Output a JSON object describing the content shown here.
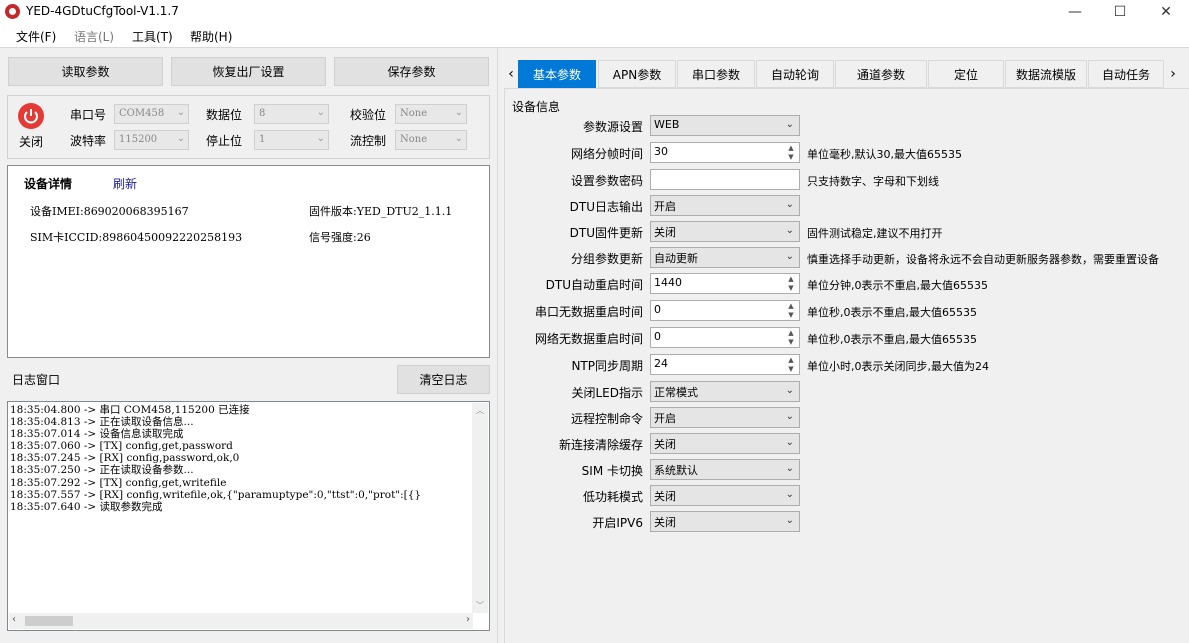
{
  "window": {
    "title": "YED-4GDtuCfgTool-V1.1.7",
    "minimize": "—",
    "maximize": "☐",
    "close": "✕"
  },
  "menu": [
    "文件(F)",
    "语言(L)",
    "工具(T)",
    "帮助(H)"
  ],
  "toolbar": {
    "read": "读取参数",
    "factory": "恢复出厂设置",
    "save": "保存参数"
  },
  "serial": {
    "close_label": "关闭",
    "port_label": "串口号",
    "port_value": "COM458",
    "baud_label": "波特率",
    "baud_value": "115200",
    "data_label": "数据位",
    "data_value": "8",
    "stop_label": "停止位",
    "stop_value": "1",
    "parity_label": "校验位",
    "parity_value": "None",
    "flow_label": "流控制",
    "flow_value": "None"
  },
  "device": {
    "title": "设备详情",
    "refresh": "刷新",
    "imei": "设备IMEI:869020068395167",
    "firmware": "固件版本:YED_DTU2_1.1.1",
    "iccid": "SIM卡ICCID:89860450092220258193",
    "signal": "信号强度:26"
  },
  "log": {
    "title": "日志窗口",
    "clear": "清空日志",
    "lines": [
      "18:35:04.800 -> 串口 COM458,115200 已连接",
      "18:35:04.813 -> 正在读取设备信息...",
      "18:35:07.014 -> 设备信息读取完成",
      "18:35:07.060 -> [TX] config,get,password",
      "18:35:07.245 -> [RX] config,password,ok,0",
      "18:35:07.250 -> 正在读取设备参数...",
      "18:35:07.292 -> [TX] config,get,writefile",
      "18:35:07.557 -> [RX] config,writefile,ok,{\"paramuptype\":0,\"ttst\":0,\"prot\":[{}",
      "18:35:07.640 -> 读取参数完成"
    ]
  },
  "tabs": [
    "基本参数",
    "APN参数",
    "串口参数",
    "自动轮询",
    "通道参数",
    "定位",
    "数据流模版",
    "自动任务"
  ],
  "group_title": "设备信息",
  "fields": [
    {
      "label": "参数源设置",
      "type": "select",
      "value": "WEB",
      "hint": ""
    },
    {
      "label": "网络分帧时间",
      "type": "spin",
      "value": "30",
      "hint": "单位毫秒,默认30,最大值65535"
    },
    {
      "label": "设置参数密码",
      "type": "text",
      "value": "",
      "hint": "只支持数字、字母和下划线"
    },
    {
      "label": "DTU日志输出",
      "type": "select",
      "value": "开启",
      "hint": ""
    },
    {
      "label": "DTU固件更新",
      "type": "select",
      "value": "关闭",
      "hint": "固件测试稳定,建议不用打开"
    },
    {
      "label": "分组参数更新",
      "type": "select",
      "value": "自动更新",
      "hint": "慎重选择手动更新，设备将永远不会自动更新服务器参数，需要重置设备"
    },
    {
      "label": "DTU自动重启时间",
      "type": "spin",
      "value": "1440",
      "hint": "单位分钟,0表示不重启,最大值65535"
    },
    {
      "label": "串口无数据重启时间",
      "type": "spin",
      "value": "0",
      "hint": "单位秒,0表示不重启,最大值65535"
    },
    {
      "label": "网络无数据重启时间",
      "type": "spin",
      "value": "0",
      "hint": "单位秒,0表示不重启,最大值65535"
    },
    {
      "label": "NTP同步周期",
      "type": "spin",
      "value": "24",
      "hint": "单位小时,0表示关闭同步,最大值为24"
    },
    {
      "label": "关闭LED指示",
      "type": "select",
      "value": "正常模式",
      "hint": ""
    },
    {
      "label": "远程控制命令",
      "type": "select",
      "value": "开启",
      "hint": ""
    },
    {
      "label": "新连接清除缓存",
      "type": "select",
      "value": "关闭",
      "hint": ""
    },
    {
      "label": "SIM 卡切换",
      "type": "select",
      "value": "系统默认",
      "hint": ""
    },
    {
      "label": "低功耗模式",
      "type": "select",
      "value": "关闭",
      "hint": ""
    },
    {
      "label": "开启IPV6",
      "type": "select",
      "value": "关闭",
      "hint": ""
    }
  ]
}
